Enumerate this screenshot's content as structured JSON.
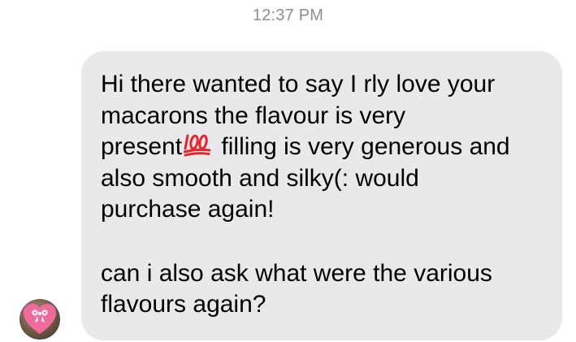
{
  "thread": {
    "timestamp": "12:37 PM"
  },
  "message": {
    "sender": "incoming",
    "paragraph1_before_emoji": "Hi there wanted to say I rly love your\nmacarons the flavour is very\npresent",
    "emoji": "hundred-points-emoji",
    "paragraph1_after_emoji": "filling is very generous and\nalso smooth and silky(: would\npurchase again!",
    "paragraph2": "can i also ask what were the various\nflavours again?"
  },
  "avatar": {
    "icon": "pink-heart-bow-avatar",
    "color": "#f06b9c"
  },
  "colors": {
    "bubble": "#e9e9eb",
    "timestamp": "#8e8e93",
    "emoji_red": "#e8242c"
  }
}
